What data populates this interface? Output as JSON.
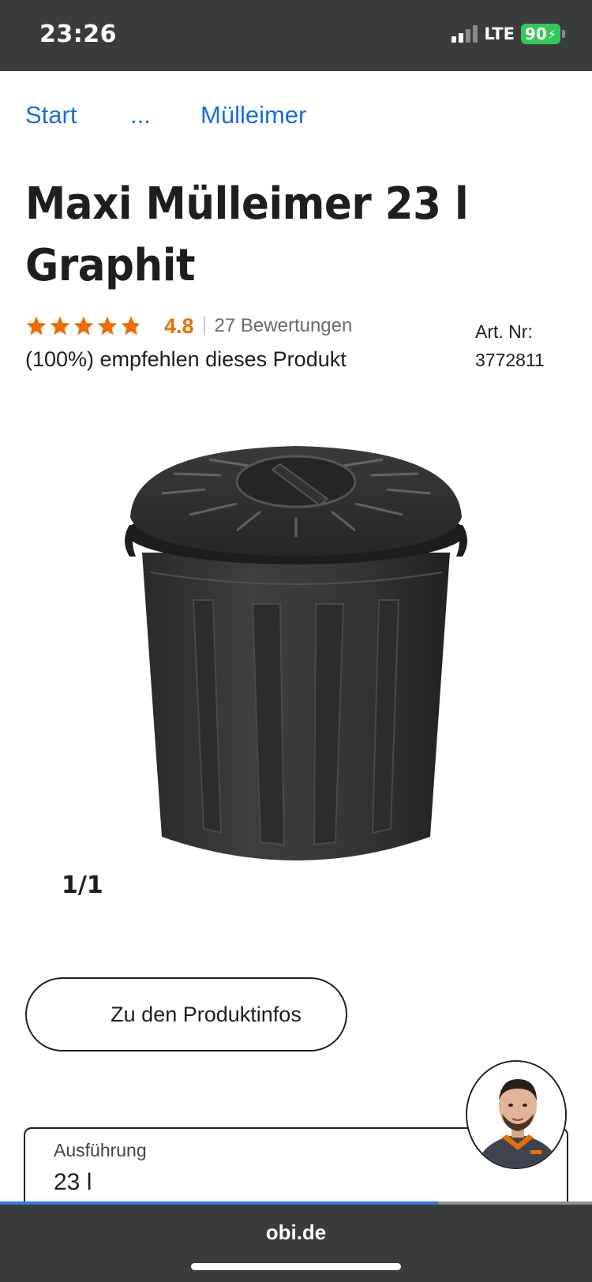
{
  "status_bar": {
    "time": "23:26",
    "network": "LTE",
    "battery": "90"
  },
  "breadcrumb": {
    "start": "Start",
    "ellipsis": "...",
    "current": "Mülleimer"
  },
  "product": {
    "title": "Maxi Mülleimer 23 l Graphit",
    "rating": {
      "stars": 4.8,
      "value": "4.8",
      "count_text": "27 Bewertungen"
    },
    "recommend_text": "(100%) empfehlen dieses Produkt",
    "art_label": "Art. Nr:",
    "art_number": "3772811",
    "image_counter": "1/1"
  },
  "actions": {
    "info_button": "Zu den Produktinfos"
  },
  "variant": {
    "label": "Ausführung",
    "value": "23 l"
  },
  "browser": {
    "url": "obi.de",
    "load_progress": 0.74
  },
  "colors": {
    "accent": "#ee6d00",
    "link": "#1a6fd6",
    "bar": "#3a3b3d"
  }
}
